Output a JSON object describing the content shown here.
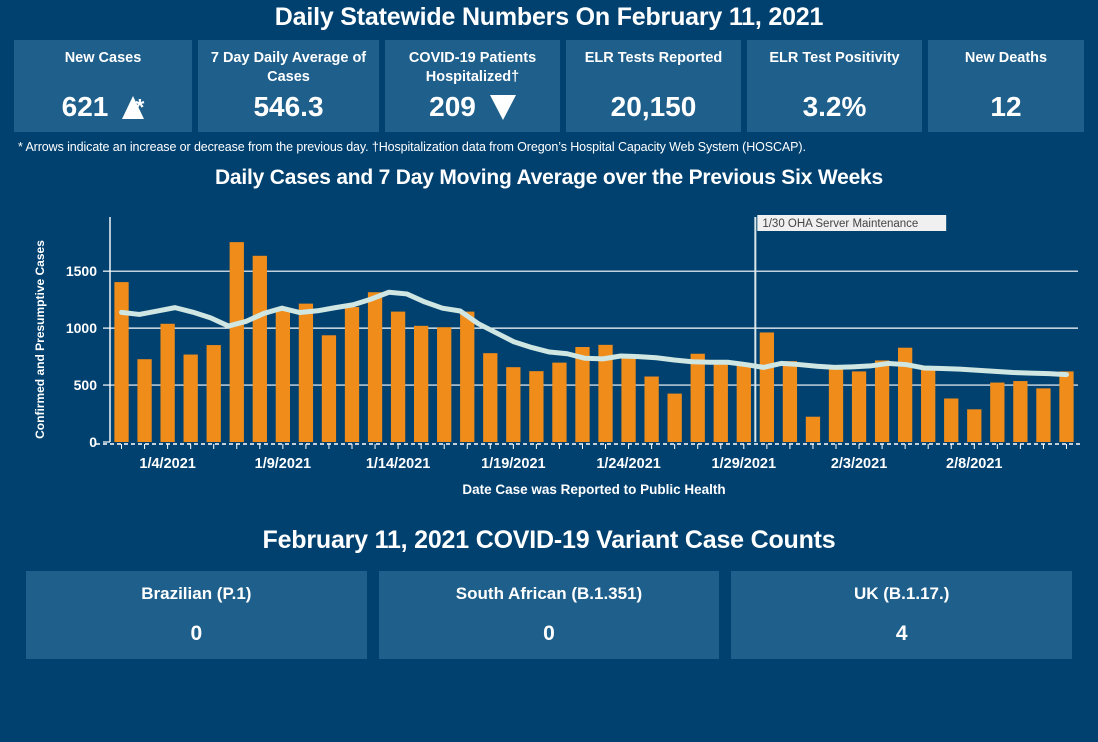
{
  "header": {
    "title": "Daily Statewide Numbers On February 11, 2021"
  },
  "kpis": [
    {
      "label": "New Cases",
      "value": "621",
      "trend": "up",
      "star": "*"
    },
    {
      "label": "7 Day Daily Average of Cases",
      "value": "546.3",
      "trend": "none",
      "star": ""
    },
    {
      "label": "COVID-19 Patients Hospitalized†",
      "value": "209",
      "trend": "down",
      "star": ""
    },
    {
      "label": "ELR Tests Reported",
      "value": "20,150",
      "trend": "none",
      "star": ""
    },
    {
      "label": "ELR Test Positivity",
      "value": "3.2%",
      "trend": "none",
      "star": ""
    },
    {
      "label": "New Deaths",
      "value": "12",
      "trend": "none",
      "star": ""
    }
  ],
  "footnote": "* Arrows indicate an increase or decrease from the previous day. †Hospitalization data from Oregon’s Hospital Capacity Web System (HOSCAP).",
  "variants": {
    "title": "February 11, 2021 COVID-19 Variant Case Counts",
    "cards": [
      {
        "label": "Brazilian (P.1)",
        "value": "0"
      },
      {
        "label": "South African (B.1.351)",
        "value": "0"
      },
      {
        "label": "UK (B.1.17.)",
        "value": "4"
      }
    ]
  },
  "colors": {
    "page_background": "#004170",
    "card_background": "#1f5f8b",
    "bar": "#f08c1a",
    "line": "#cfe6e2",
    "gridline": "#ffffff",
    "text": "#ffffff",
    "annotation_box": "#f0f0f0",
    "annotation_text": "#444444"
  },
  "chart_data": {
    "type": "bar",
    "title": "Daily Cases and 7 Day Moving Average over the Previous Six Weeks",
    "xlabel": "Date Case was Reported to Public Health",
    "ylabel": "Confirmed and Presumptive Cases",
    "ylim": [
      0,
      1800
    ],
    "yticks": [
      0,
      500,
      1000,
      1500
    ],
    "ytick_labels": [
      "0",
      "500",
      "1000",
      "1500"
    ],
    "grid": true,
    "legend": null,
    "xtick_labels": [
      "1/4/2021",
      "1/9/2021",
      "1/14/2021",
      "1/19/2021",
      "1/24/2021",
      "1/29/2021",
      "2/3/2021",
      "2/8/2021"
    ],
    "xtick_indices": [
      2,
      7,
      12,
      17,
      22,
      27,
      32,
      37
    ],
    "x": [
      "1/2/2021",
      "1/3/2021",
      "1/4/2021",
      "1/5/2021",
      "1/6/2021",
      "1/7/2021",
      "1/8/2021",
      "1/9/2021",
      "1/10/2021",
      "1/11/2021",
      "1/12/2021",
      "1/13/2021",
      "1/14/2021",
      "1/15/2021",
      "1/16/2021",
      "1/17/2021",
      "1/18/2021",
      "1/19/2021",
      "1/20/2021",
      "1/21/2021",
      "1/22/2021",
      "1/23/2021",
      "1/24/2021",
      "1/25/2021",
      "1/26/2021",
      "1/27/2021",
      "1/28/2021",
      "1/29/2021",
      "1/30/2021",
      "1/31/2021",
      "2/1/2021",
      "2/2/2021",
      "2/3/2021",
      "2/4/2021",
      "2/5/2021",
      "2/6/2021",
      "2/7/2021",
      "2/8/2021",
      "2/9/2021",
      "2/10/2021",
      "2/11/2021",
      "2/12/2021"
    ],
    "series": [
      {
        "name": "Confirmed and Presumptive Cases",
        "type": "bar",
        "color": "#f08c1a",
        "values": [
          1404,
          727,
          1038,
          768,
          851,
          1755,
          1635,
          1160,
          1215,
          937,
          1185,
          1315,
          1145,
          1020,
          1008,
          1145,
          780,
          657,
          622,
          697,
          834,
          853,
          760,
          575,
          425,
          775,
          688,
          695,
          962,
          710,
          222,
          670,
          620,
          716,
          828,
          660,
          382,
          287,
          522,
          535,
          471,
          620
        ]
      },
      {
        "name": "7 Day Moving Average",
        "type": "line",
        "color": "#cfe6e2",
        "values": [
          1138,
          1120,
          1150,
          1180,
          1140,
          1090,
          1018,
          1060,
          1130,
          1175,
          1137,
          1152,
          1180,
          1205,
          1255,
          1315,
          1300,
          1230,
          1175,
          1150,
          1040,
          960,
          880,
          830,
          790,
          775,
          735,
          730,
          755,
          750,
          740,
          720,
          705,
          700,
          700,
          680,
          655,
          690,
          680,
          665,
          655,
          660,
          668,
          690,
          680,
          650,
          645,
          640,
          630,
          620,
          610,
          605,
          600,
          592
        ]
      }
    ],
    "annotations": [
      {
        "text": "1/30 OHA Server Maintenance",
        "type": "vertical-reference-line",
        "x": "1/30/2021"
      }
    ]
  }
}
